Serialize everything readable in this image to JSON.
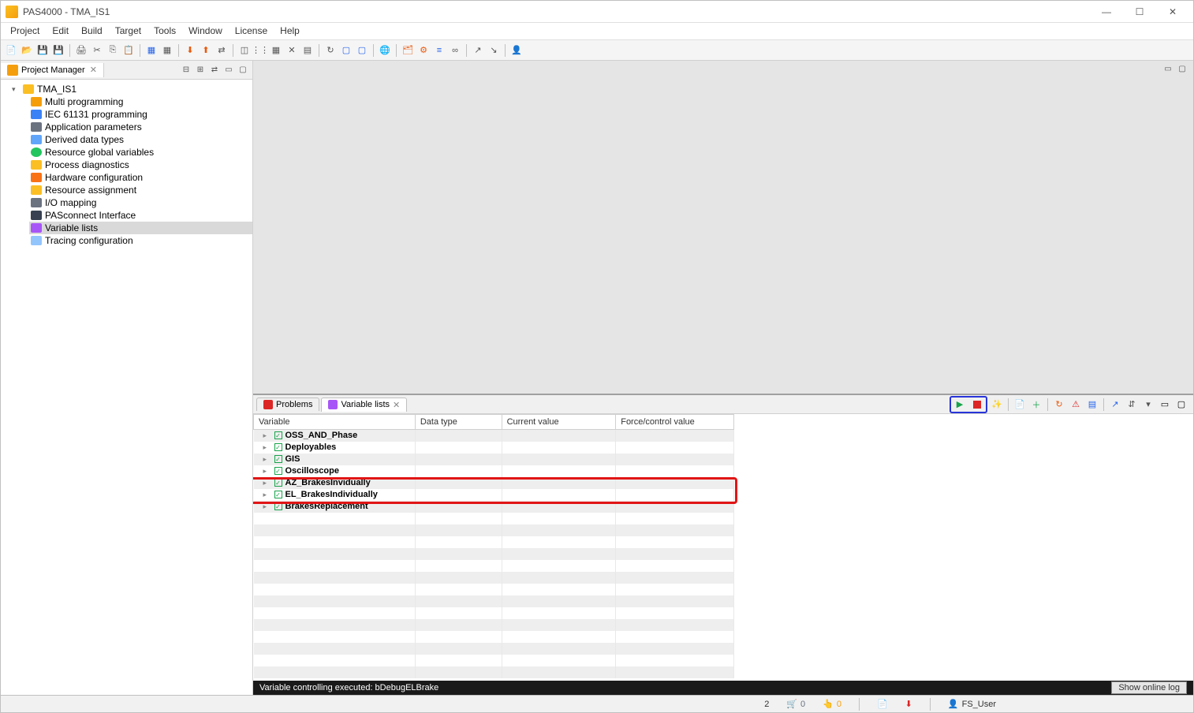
{
  "window": {
    "title": "PAS4000 - TMA_IS1"
  },
  "menus": [
    "Project",
    "Edit",
    "Build",
    "Target",
    "Tools",
    "Window",
    "License",
    "Help"
  ],
  "projectManager": {
    "title": "Project Manager",
    "root": "TMA_IS1",
    "items": [
      {
        "label": "Multi programming",
        "icon": "ic-multi"
      },
      {
        "label": "IEC 61131 programming",
        "icon": "ic-iec"
      },
      {
        "label": "Application parameters",
        "icon": "ic-app"
      },
      {
        "label": "Derived data types",
        "icon": "ic-derived"
      },
      {
        "label": "Resource global variables",
        "icon": "ic-global"
      },
      {
        "label": "Process diagnostics",
        "icon": "ic-proc"
      },
      {
        "label": "Hardware configuration",
        "icon": "ic-hw"
      },
      {
        "label": "Resource assignment",
        "icon": "ic-res"
      },
      {
        "label": "I/O mapping",
        "icon": "ic-io"
      },
      {
        "label": "PASconnect Interface",
        "icon": "ic-pas"
      },
      {
        "label": "Variable lists",
        "icon": "ic-var",
        "selected": true
      },
      {
        "label": "Tracing configuration",
        "icon": "ic-trace"
      }
    ]
  },
  "bottomTabs": {
    "problems": "Problems",
    "varlists": "Variable lists"
  },
  "varTable": {
    "cols": {
      "variable": "Variable",
      "datatype": "Data type",
      "current": "Current value",
      "force": "Force/control value"
    },
    "rows": [
      {
        "name": "OSS_AND_Phase",
        "alt": true
      },
      {
        "name": "Deployables",
        "alt": false
      },
      {
        "name": "GIS",
        "alt": true
      },
      {
        "name": "Oscilloscope",
        "alt": false
      },
      {
        "name": "AZ_BrakesInvidually",
        "alt": true,
        "highlight": true
      },
      {
        "name": "EL_BrakesIndividually",
        "alt": false,
        "highlight": true
      },
      {
        "name": "BrakesReplacement",
        "alt": true
      }
    ]
  },
  "status1": {
    "msg": "Variable controlling executed: bDebugELBrake",
    "btn": "Show online log"
  },
  "status2": {
    "num": "2",
    "cart": "0",
    "hand": "0",
    "user": "FS_User"
  }
}
